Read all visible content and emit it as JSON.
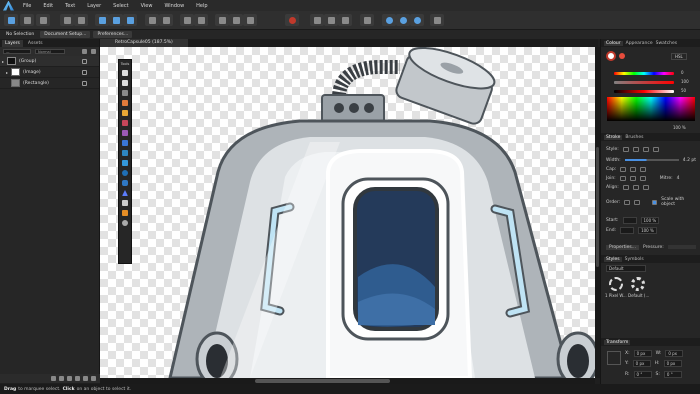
{
  "menubar": {
    "items": [
      "File",
      "Edit",
      "Text",
      "Layer",
      "Select",
      "View",
      "Window",
      "Help"
    ]
  },
  "context": {
    "selection_label": "No Selection",
    "doc_setup_label": "Document Setup...",
    "prefs_label": "Preferences..."
  },
  "layers_panel": {
    "tabs": [
      "Layers",
      "Assets"
    ],
    "blend_mode": "Normal",
    "opacity_label": "—",
    "layers": [
      {
        "name": "(Group)"
      },
      {
        "name": "(Image)"
      },
      {
        "name": "(Rectangle)"
      }
    ]
  },
  "document": {
    "tab_title": "RetroCapsule05 (187.5%)"
  },
  "tools": {
    "title": "Tools",
    "colors": [
      "#dddddd",
      "#dddddd",
      "#8a8a8a",
      "#e27b3b",
      "#e8a735",
      "#c6465a",
      "#9b59b6",
      "#3a76d6",
      "#2e86c1",
      "#3498db",
      "#1f6fb5",
      "#2f78c4",
      "#5c7cfa",
      "#cccccc",
      "#e58e26",
      "#aaaaaa"
    ]
  },
  "statusbar": {
    "drag_bold": "Drag",
    "drag_text": " to marquee select. ",
    "click_bold": "Click",
    "click_text": " on an object to select it."
  },
  "colour_panel": {
    "tabs": [
      "Colour",
      "Appearance",
      "Swatches"
    ],
    "model": "HSL",
    "h_value": "0",
    "s_value": "100",
    "l_value": "50",
    "opacity": "100 %"
  },
  "stroke_panel": {
    "tabs": [
      "Stroke",
      "Brushes"
    ],
    "style_label": "Style:",
    "width_label": "Width:",
    "width_value": "4.2 pt",
    "cap_label": "Cap:",
    "join_label": "Join:",
    "mitre_label": "Mitre:",
    "mitre_value": "4",
    "align_label": "Align:",
    "order_label": "Order:",
    "scale_label": "Scale with object",
    "start_label": "Start:",
    "end_label": "End:",
    "start_pct": "100 %",
    "end_pct": "100 %",
    "properties_label": "Properties...",
    "pressure_label": "Pressure:"
  },
  "styles_panel": {
    "tabs": [
      "Styles",
      "Symbols"
    ],
    "category": "Default",
    "items": [
      "1 Pixel W...",
      "Default (..."
    ]
  },
  "transform_panel": {
    "tabs": [
      "Transform"
    ],
    "x_label": "X:",
    "y_label": "Y:",
    "w_label": "W:",
    "h_label": "H:",
    "r_label": "R:",
    "s_label": "S:",
    "x_value": "0 px",
    "y_value": "0 px",
    "w_value": "0 px",
    "h_value": "0 px",
    "r_value": "0 °",
    "s_value": "0 °"
  }
}
